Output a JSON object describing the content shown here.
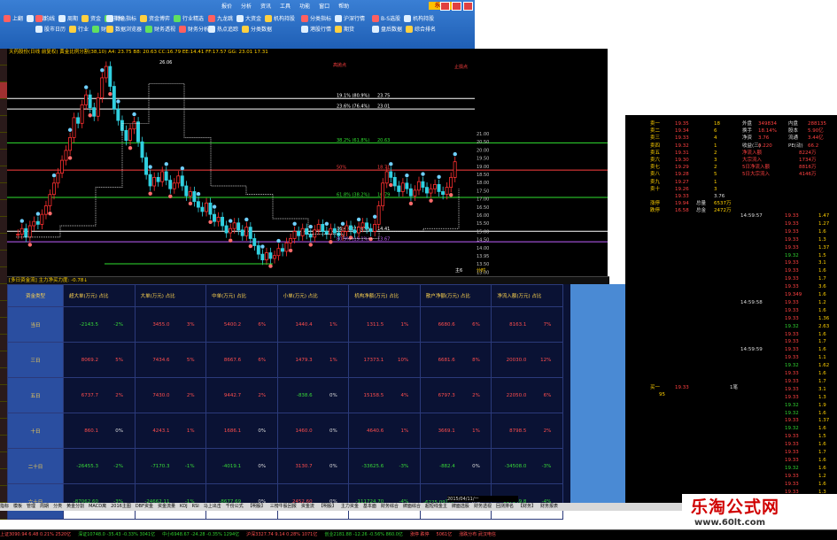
{
  "menu": [
    "报价",
    "分析",
    "资讯",
    "工具",
    "功能",
    "窗口",
    "帮助"
  ],
  "toolbar": {
    "group1": [
      "上翻",
      "下翻"
    ],
    "group2_top": [
      "均线",
      "周期",
      "资金",
      "指标"
    ],
    "group2_bottom": [
      "股市日历",
      "行业",
      "财务"
    ],
    "group3_top": [
      "特色指标",
      "资金博弈",
      "行业精选"
    ],
    "group3_bottom": [
      "数据浏览器",
      "财务透视",
      "财务分析"
    ],
    "group4_top": [
      "九龙跳",
      "大资金",
      "机构持股"
    ],
    "group4_bottom": [
      "热点追踪",
      "分类数据"
    ],
    "group5_top": [
      "分类指标",
      "沪深行情"
    ],
    "group5_bottom": [
      "港股行情",
      "期货"
    ],
    "group6_top": [
      "B-S选股",
      "机构持股"
    ],
    "group6_bottom": [
      "盘后数据",
      "综合排名"
    ]
  },
  "logo_text": "乐淘",
  "chart": {
    "header": "天药股份(日线 前复权) 黄金比例分割(38,10)  A4: 23.75 B8: 20.63 CC:16.79 EE:14.41 FF:17.57 GG: 23.01   17.31",
    "top_label": "26.06",
    "levels": [
      {
        "label": "19.1% (80.9%)",
        "value": "23.75",
        "color": "#ffffff"
      },
      {
        "label": "23.6% (76.4%)",
        "value": "23.01",
        "color": "#ffffff"
      },
      {
        "label": "38.2% (61.8%)",
        "value": "20.63",
        "color": "#30e030"
      },
      {
        "label": "50%",
        "value": "18.71",
        "color": "#ff4040"
      },
      {
        "label": "61.8% (38.2%)",
        "value": "16.79",
        "color": "#30e030"
      },
      {
        "label": "76.4% (23.6%)",
        "value": "14.41",
        "color": "#ffffff"
      },
      {
        "label": "80.9% (19.1%)",
        "value": "13.67",
        "color": "#c060ff"
      }
    ],
    "badge_left": "高抛点",
    "badge_right": "止损点",
    "right_axis": [
      "21.00",
      "20.50",
      "20.00",
      "19.50",
      "19.00",
      "18.50",
      "18.00",
      "17.50",
      "17.00",
      "16.50",
      "16.00",
      "15.50",
      "15.00",
      "14.50",
      "14.00",
      "13.95",
      "13.50",
      "13.00",
      "12.50",
      "12.00",
      "11.50"
    ]
  },
  "midbar": "[多日资金流]  主力净买力度: -0.78↓",
  "fund_table": {
    "header_first": "资金类型",
    "headers": [
      "超大单(万元)  占比",
      "大单(万元)  占比",
      "中单(万元)  占比",
      "小单(万元)  占比",
      "机构净额(万元)  占比",
      "散户净额(万元)  占比",
      "净流入额(万元)  占比"
    ],
    "rows": [
      {
        "label": "当日",
        "cells": [
          [
            "-2143.5",
            "-2%"
          ],
          [
            "3455.0",
            "3%"
          ],
          [
            "5400.2",
            "6%"
          ],
          [
            "1440.4",
            "1%"
          ],
          [
            "1311.5",
            "1%"
          ],
          [
            "6680.6",
            "6%"
          ],
          [
            "8163.1",
            "7%"
          ]
        ]
      },
      {
        "label": "三日",
        "cells": [
          [
            "8069.2",
            "5%"
          ],
          [
            "7434.6",
            "5%"
          ],
          [
            "8667.6",
            "6%"
          ],
          [
            "1479.3",
            "1%"
          ],
          [
            "17373.1",
            "10%"
          ],
          [
            "6681.6",
            "8%"
          ],
          [
            "20030.0",
            "12%"
          ]
        ]
      },
      {
        "label": "五日",
        "cells": [
          [
            "6737.7",
            "2%"
          ],
          [
            "7430.0",
            "2%"
          ],
          [
            "9442.7",
            "2%"
          ],
          [
            "-838.6",
            "0%"
          ],
          [
            "15158.5",
            "4%"
          ],
          [
            "6797.3",
            "2%"
          ],
          [
            "22050.0",
            "6%"
          ]
        ]
      },
      {
        "label": "十日",
        "cells": [
          [
            "860.1",
            "0%"
          ],
          [
            "4243.1",
            "1%"
          ],
          [
            "1686.1",
            "0%"
          ],
          [
            "1460.0",
            "0%"
          ],
          [
            "4640.6",
            "1%"
          ],
          [
            "3669.1",
            "1%"
          ],
          [
            "8798.5",
            "2%"
          ]
        ]
      },
      {
        "label": "二十日",
        "cells": [
          [
            "-26455.3",
            "-2%"
          ],
          [
            "-7170.3",
            "-1%"
          ],
          [
            "-4019.1",
            "0%"
          ],
          [
            "3130.7",
            "0%"
          ],
          [
            "-33625.6",
            "-3%"
          ],
          [
            "-882.4",
            "0%"
          ],
          [
            "-34508.0",
            "-3%"
          ]
        ]
      },
      {
        "label": "六十日",
        "cells": [
          [
            "-87062.60",
            "-3%"
          ],
          [
            "-24662.11",
            "-1%"
          ],
          [
            "-8677.69",
            "0%"
          ],
          [
            "2452.60",
            "0%"
          ],
          [
            "-111724.70",
            "-4%"
          ],
          [
            "-6225.09万元",
            "0%"
          ],
          [
            "-117949.8",
            "-4%"
          ]
        ]
      }
    ]
  },
  "quote": {
    "sell_labels": [
      "卖一",
      "卖二",
      "卖三",
      "卖四",
      "卖五",
      "卖六",
      "卖七",
      "卖八",
      "卖九",
      "卖十"
    ],
    "sell_prices": [
      "19.35",
      "19.34",
      "19.33",
      "19.32",
      "19.31",
      "19.30",
      "19.29",
      "19.28",
      "19.27",
      "19.26"
    ],
    "sell_vols": [
      "18",
      "6",
      "4",
      "1",
      "2",
      "3",
      "2",
      "5",
      "1",
      "3"
    ],
    "cur_price": "19.33",
    "change": "3.76",
    "stats": [
      {
        "k": "外盘",
        "v": "349834"
      },
      {
        "k": "内盘",
        "v": "288135"
      },
      {
        "k": "换手",
        "v": "18.14%"
      },
      {
        "k": "股本",
        "v": "5.90亿"
      },
      {
        "k": "净资",
        "v": "3.76"
      },
      {
        "k": "流通",
        "v": "3.44亿"
      },
      {
        "k": "收益(三)",
        "v": "0.220"
      },
      {
        "k": "PE(动)",
        "v": "66.2"
      }
    ],
    "flows": [
      {
        "k": "净流入额",
        "v": "8224万"
      },
      {
        "k": "大宗流入",
        "v": "1734万"
      },
      {
        "k": "5日净流入额",
        "v": "8816万"
      },
      {
        "k": "5日大宗流入",
        "v": "4146万"
      }
    ],
    "lower": [
      {
        "k": "涨停",
        "v": "19.94"
      },
      {
        "k": "总量",
        "v": "6537万"
      },
      {
        "k": "跌停",
        "v": "16.58"
      },
      {
        "k": "总金",
        "v": "2472万"
      }
    ],
    "buy_label": "买一",
    "buy_price": "19.33",
    "buy_vol": "95",
    "buy_count": "1笔"
  },
  "ticks": [
    {
      "t": "14:59:57",
      "p": "19.33",
      "v": "1.47",
      "c": "r"
    },
    {
      "t": "",
      "p": "19.33",
      "v": "1.27",
      "c": "r"
    },
    {
      "t": "",
      "p": "19.33",
      "v": "1.6",
      "c": "r"
    },
    {
      "t": "",
      "p": "19.33",
      "v": "1.3",
      "c": "r"
    },
    {
      "t": "",
      "p": "19.33",
      "v": "1.37",
      "c": "r"
    },
    {
      "t": "",
      "p": "19.32",
      "v": "1.5",
      "c": "g"
    },
    {
      "t": "",
      "p": "19.33",
      "v": "3.1",
      "c": "r"
    },
    {
      "t": "",
      "p": "19.33",
      "v": "1.6",
      "c": "r"
    },
    {
      "t": "",
      "p": "19.33",
      "v": "1.7",
      "c": "r"
    },
    {
      "t": "",
      "p": "19.33",
      "v": "3.6",
      "c": "r"
    },
    {
      "t": "",
      "p": "19.349",
      "v": "1.6",
      "c": "r"
    },
    {
      "t": "14:59:58",
      "p": "19.33",
      "v": "1.2",
      "c": "r"
    },
    {
      "t": "",
      "p": "19.33",
      "v": "1.6",
      "c": "r"
    },
    {
      "t": "",
      "p": "19.33",
      "v": "1.36",
      "c": "r"
    },
    {
      "t": "",
      "p": "19.32",
      "v": "2.63",
      "c": "g"
    },
    {
      "t": "",
      "p": "19.33",
      "v": "1.6",
      "c": "r"
    },
    {
      "t": "",
      "p": "19.33",
      "v": "1.7",
      "c": "r"
    },
    {
      "t": "14:59:59",
      "p": "19.33",
      "v": "1.6",
      "c": "r"
    },
    {
      "t": "",
      "p": "19.33",
      "v": "1.1",
      "c": "r"
    },
    {
      "t": "",
      "p": "19.32",
      "v": "1.62",
      "c": "g"
    },
    {
      "t": "",
      "p": "19.33",
      "v": "1.6",
      "c": "r"
    },
    {
      "t": "",
      "p": "19.33",
      "v": "1.7",
      "c": "r"
    },
    {
      "t": "",
      "p": "19.33",
      "v": "3.1",
      "c": "r"
    },
    {
      "t": "",
      "p": "19.33",
      "v": "1.3",
      "c": "r"
    },
    {
      "t": "",
      "p": "19.32",
      "v": "1.9",
      "c": "g"
    },
    {
      "t": "",
      "p": "19.32",
      "v": "1.6",
      "c": "g"
    },
    {
      "t": "",
      "p": "19.33",
      "v": "1.37",
      "c": "r"
    },
    {
      "t": "",
      "p": "19.32",
      "v": "1.6",
      "c": "g"
    },
    {
      "t": "",
      "p": "19.33",
      "v": "1.5",
      "c": "r"
    },
    {
      "t": "",
      "p": "19.33",
      "v": "1.6",
      "c": "r"
    },
    {
      "t": "",
      "p": "19.33",
      "v": "1.7",
      "c": "r"
    },
    {
      "t": "",
      "p": "19.33",
      "v": "1.6",
      "c": "r"
    },
    {
      "t": "",
      "p": "19.32",
      "v": "1.6",
      "c": "g"
    },
    {
      "t": "",
      "p": "19.33",
      "v": "1.2",
      "c": "r"
    },
    {
      "t": "",
      "p": "19.33",
      "v": "1.6",
      "c": "r"
    },
    {
      "t": "",
      "p": "19.33",
      "v": "1.3",
      "c": "r"
    }
  ],
  "date_label": "2015/04/11/一",
  "right_mini_label": "分时",
  "bottom_tabs": [
    "指标",
    "模板",
    "管理",
    "周期",
    "分类",
    "黄金分割",
    "MACD离",
    "2016主图",
    "DBF资金",
    "资金流量",
    "KDJ",
    "RSI",
    "马上出击",
    "千份公式",
    "【明股】",
    "三榜牛股回报",
    "资金流",
    "【明股】",
    "主力资金",
    "基本面",
    "财务综合",
    "牌面综合",
    "超短线金主",
    "牌面选股",
    "财务透视",
    "回测排名",
    "【财务】",
    "财务报表"
  ],
  "status": [
    "上证3090.94  6.48  0.21%  2520亿",
    "深证10748.0 -35.43 -0.33%  3041亿",
    "中小6948.67 -24.28 -0.35%  1294亿",
    "沪深3327.74  9.14  0.28%  1071亿",
    "创业2181.88 -12.26 -0.56%  860.0亿",
    "涨停 跌停",
    "5061亿",
    "涨跌分布 武汉电信"
  ],
  "watermark": {
    "line1": "乐淘公式网",
    "line2": "www.60lt.com"
  },
  "chart_badge_bottom": "主6"
}
